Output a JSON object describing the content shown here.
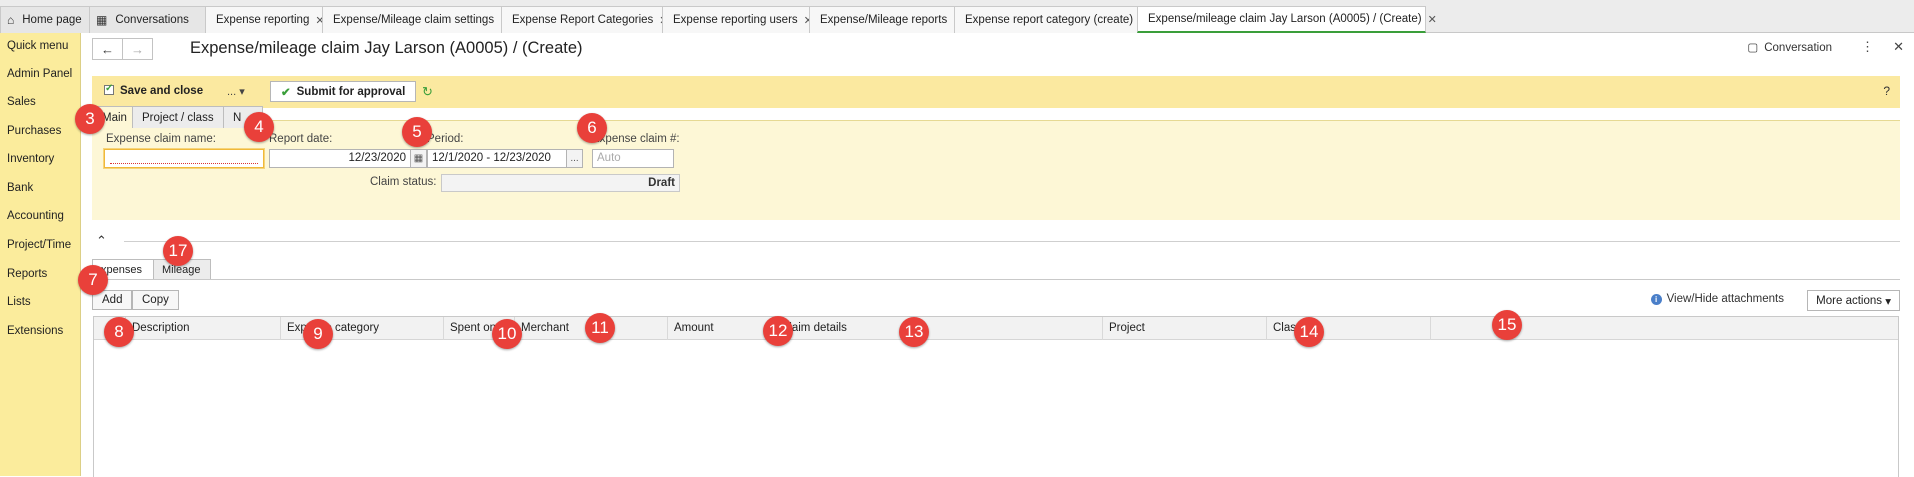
{
  "tabs": {
    "home": "Home page",
    "conversations": "Conversations",
    "items": [
      "Expense reporting",
      "Expense/Mileage claim settings",
      "Expense Report Categories",
      "Expense reporting users",
      "Expense/Mileage reports",
      "Expense report category (create)",
      "Expense/mileage claim Jay Larson (A0005) / (Create)"
    ]
  },
  "menu": [
    "Quick menu",
    "Admin Panel",
    "Sales",
    "Purchases",
    "Inventory",
    "Bank",
    "Accounting",
    "Project/Time",
    "Reports",
    "Lists",
    "Extensions"
  ],
  "header": {
    "title": "Expense/mileage claim Jay Larson (A0005) / (Create)",
    "conversation": "Conversation"
  },
  "toolbar": {
    "save_close": "Save and close",
    "more": "...",
    "submit": "Submit for approval",
    "help": "?"
  },
  "form": {
    "tabs": [
      "Main",
      "Project / class",
      "N"
    ],
    "claim_name_label": "Expense claim name:",
    "claim_name_value": "",
    "report_date_label": "Report date:",
    "report_date_value": "12/23/2020",
    "period_label": "Period:",
    "period_value": "12/1/2020 - 12/23/2020",
    "claim_no_label": "Expense claim #:",
    "claim_no_placeholder": "Auto",
    "status_label": "Claim status:",
    "status_value": "Draft"
  },
  "lower": {
    "tabs": [
      "xpenses",
      "Mileage"
    ],
    "add": "Add",
    "copy": "Copy",
    "view_hide": "View/Hide attachments",
    "more_actions": "More actions",
    "columns": [
      "Description",
      "Expense category",
      "Spent on",
      "Merchant",
      "Amount",
      "Claim details",
      "Project",
      "Class"
    ]
  },
  "markers": [
    "3",
    "4",
    "5",
    "6",
    "7",
    "17",
    "8",
    "9",
    "10",
    "11",
    "12",
    "13",
    "14",
    "15"
  ]
}
